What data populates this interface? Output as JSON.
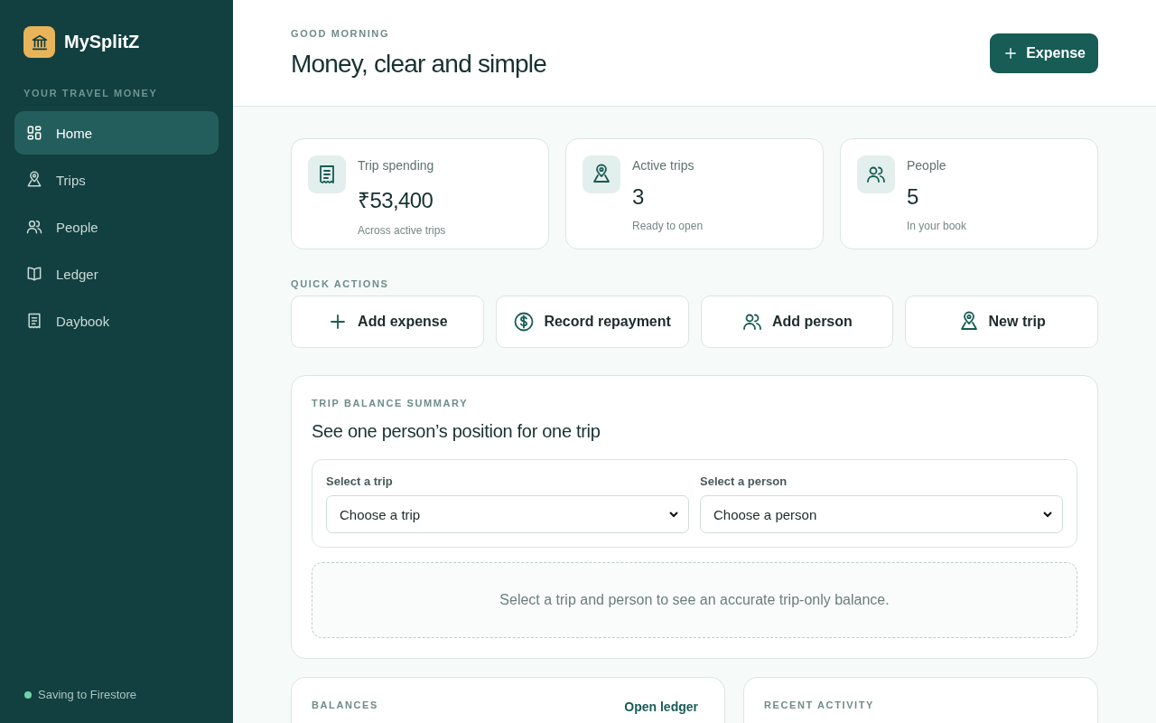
{
  "brand": {
    "name": "MySplitZ"
  },
  "sidebar": {
    "section": "YOUR TRAVEL MONEY",
    "items": [
      {
        "label": "Home",
        "kind": "grid",
        "selected": true
      },
      {
        "label": "Trips",
        "kind": "pin",
        "selected": false
      },
      {
        "label": "People",
        "kind": "people",
        "selected": false
      },
      {
        "label": "Ledger",
        "kind": "book",
        "selected": false
      },
      {
        "label": "Daybook",
        "kind": "receipt",
        "selected": false
      }
    ],
    "status": {
      "text": "Saving to Firestore",
      "color": "#6fd3a8"
    }
  },
  "header": {
    "eyebrow": "GOOD MORNING",
    "title": "Money, clear and simple",
    "button": "Expense"
  },
  "stats": [
    {
      "kind": "receipt",
      "label": "Trip spending",
      "value": "₹53,400",
      "note": "Across active trips"
    },
    {
      "kind": "pin",
      "label": "Active trips",
      "value": "3",
      "note": "Ready to open"
    },
    {
      "kind": "people",
      "label": "People",
      "value": "5",
      "note": "In your book"
    }
  ],
  "quick_actions": {
    "title": "QUICK ACTIONS",
    "items": [
      {
        "kind": "plus",
        "label": "Add expense"
      },
      {
        "kind": "dollar",
        "label": "Record repayment"
      },
      {
        "kind": "people",
        "label": "Add person"
      },
      {
        "kind": "pin",
        "label": "New trip"
      }
    ]
  },
  "summary": {
    "eyebrow": "TRIP BALANCE SUMMARY",
    "title": "See one person’s position for one trip",
    "fields": [
      {
        "label": "Select a trip",
        "value": "Choose a trip"
      },
      {
        "label": "Select a person",
        "value": "Choose a person"
      }
    ],
    "empty": "Select a trip and person to see an accurate trip-only balance."
  },
  "balances": {
    "title": "BALANCES",
    "link": "Open ledger"
  },
  "recent_activity": {
    "title": "RECENT ACTIVITY"
  }
}
